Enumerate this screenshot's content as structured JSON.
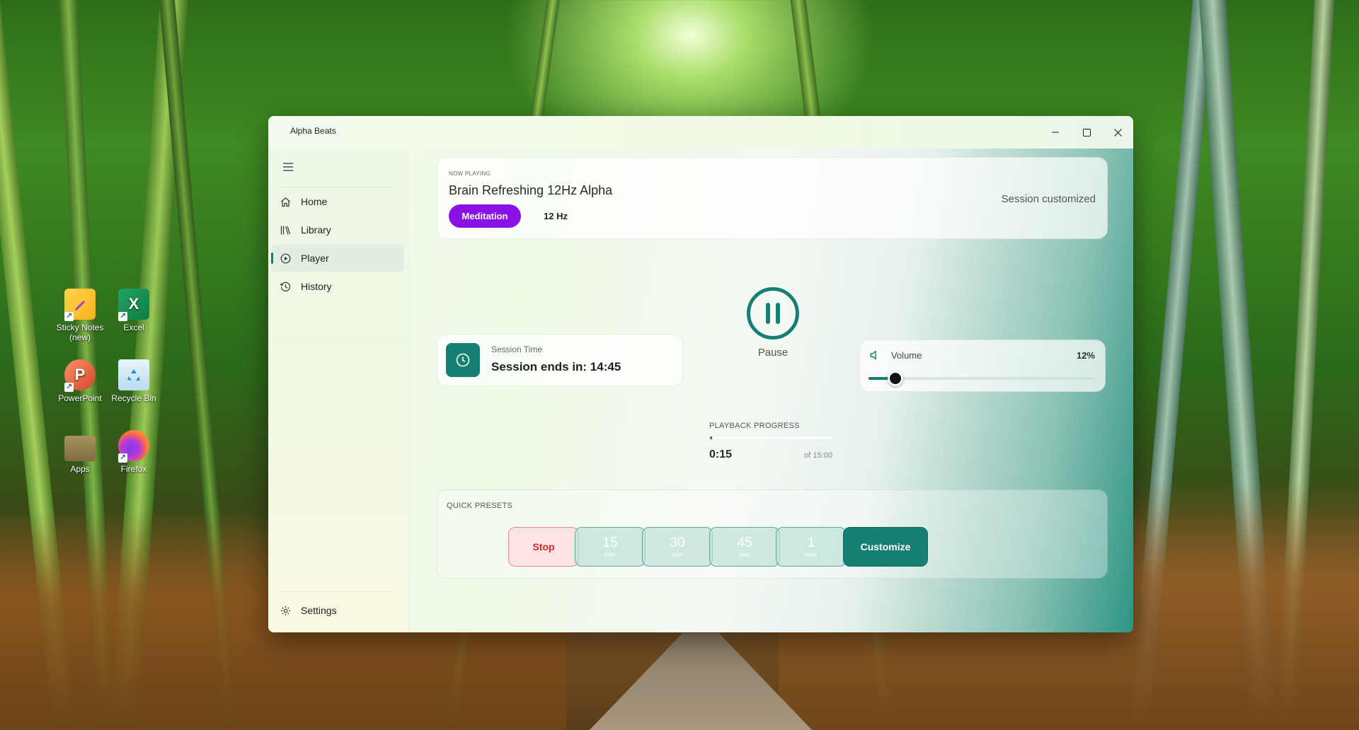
{
  "desktop": {
    "icons": [
      {
        "label": "Sticky Notes (new)",
        "icon": "sticky-notes-icon"
      },
      {
        "label": "Excel",
        "icon": "excel-icon"
      },
      {
        "label": "PowerPoint",
        "icon": "powerpoint-icon"
      },
      {
        "label": "Recycle Bin",
        "icon": "recycle-bin-icon"
      },
      {
        "label": "Apps",
        "icon": "folder-icon"
      },
      {
        "label": "Firefox",
        "icon": "firefox-icon"
      }
    ]
  },
  "window": {
    "title": "Alpha Beats",
    "controls": {
      "minimize": "minimize-icon",
      "maximize": "maximize-icon",
      "close": "close-icon"
    }
  },
  "sidebar": {
    "items": [
      {
        "label": "Home",
        "icon": "home-icon"
      },
      {
        "label": "Library",
        "icon": "library-icon"
      },
      {
        "label": "Player",
        "icon": "play-circle-icon",
        "active": true
      },
      {
        "label": "History",
        "icon": "history-icon"
      }
    ],
    "settings": {
      "label": "Settings",
      "icon": "gear-icon"
    }
  },
  "now_playing": {
    "label": "NOW PLAYING",
    "title": "Brain Refreshing 12Hz Alpha",
    "category": "Meditation",
    "frequency": "12 Hz",
    "status": "Session customized"
  },
  "player": {
    "pause_label": "Pause"
  },
  "session": {
    "label": "Session Time",
    "value": "Session ends in: 14:45"
  },
  "volume": {
    "label": "Volume",
    "value_text": "12%",
    "level": 0.12
  },
  "progress": {
    "label": "PLAYBACK PROGRESS",
    "current": "0:15",
    "total": "of 15:00",
    "fraction": 0.0167
  },
  "presets": {
    "label": "QUICK PRESETS",
    "stop": "Stop",
    "timers": [
      {
        "num": "15",
        "unit": "min"
      },
      {
        "num": "30",
        "unit": "min"
      },
      {
        "num": "45",
        "unit": "min"
      },
      {
        "num": "1",
        "unit": "hour"
      }
    ],
    "customize": "Customize"
  },
  "colors": {
    "accent": "#167f74",
    "meditation_tag": "#8a12e6",
    "stop": "#d22a2a"
  }
}
